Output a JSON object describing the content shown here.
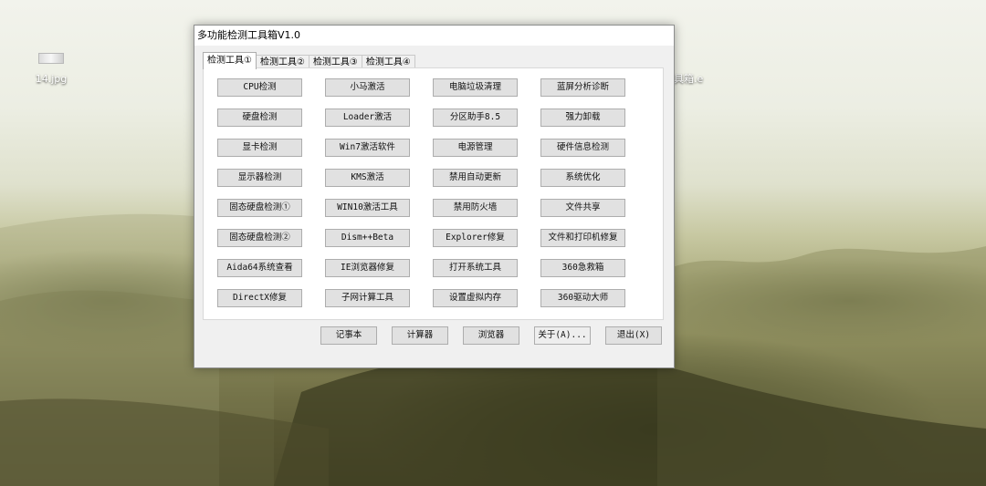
{
  "desktop": {
    "icons": [
      {
        "label": "14.jpg"
      },
      {
        "label": "具箱.e"
      }
    ]
  },
  "window": {
    "title": "多功能检测工具箱V1.0",
    "tabs": [
      {
        "label": "检测工具①",
        "active": true
      },
      {
        "label": "检测工具②",
        "active": false
      },
      {
        "label": "检测工具③",
        "active": false
      },
      {
        "label": "检测工具④",
        "active": false
      }
    ],
    "tool_buttons": [
      "CPU检测",
      "小马激活",
      "电脑垃圾清理",
      "蓝屏分析诊断",
      "硬盘检测",
      "Loader激活",
      "分区助手8.5",
      "强力卸载",
      "显卡检测",
      "Win7激活软件",
      "电源管理",
      "硬件信息检测",
      "显示器检测",
      "KMS激活",
      "禁用自动更新",
      "系统优化",
      "固态硬盘检测①",
      "WIN10激活工具",
      "禁用防火墙",
      "文件共享",
      "固态硬盘检测②",
      "Dism++Beta",
      "Explorer修复",
      "文件和打印机修复",
      "Aida64系统查看",
      "IE浏览器修复",
      "打开系统工具",
      "360急救箱",
      "DirectX修复",
      "子网计算工具",
      "设置虚拟内存",
      "360驱动大师"
    ],
    "bottom_buttons": [
      {
        "label": "记事本"
      },
      {
        "label": "计算器"
      },
      {
        "label": "浏览器"
      },
      {
        "label": "关于(A)..."
      },
      {
        "label": "退出(X)"
      }
    ]
  }
}
